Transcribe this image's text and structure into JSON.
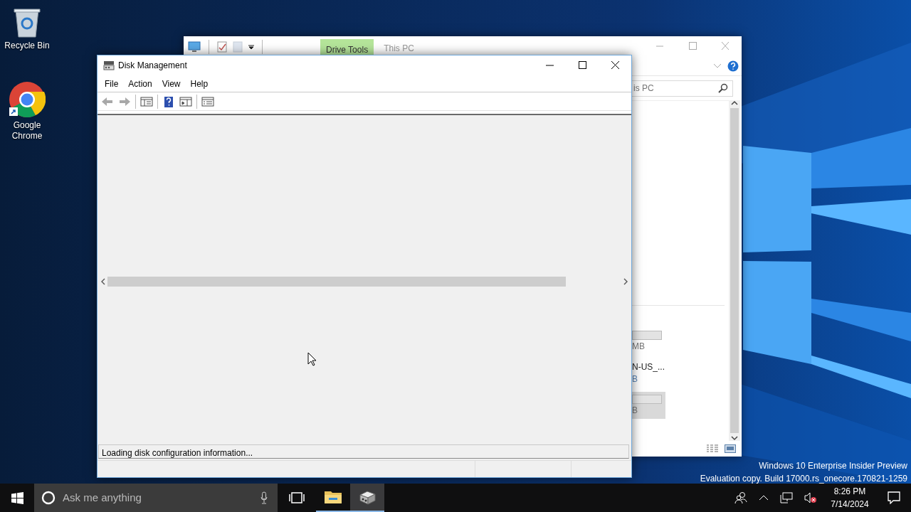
{
  "desktop_icons": [
    {
      "kind": "trash",
      "label": "Recycle Bin"
    },
    {
      "kind": "browser",
      "label": "Google Chrome"
    }
  ],
  "explorer_window": {
    "context_tab": "Drive Tools",
    "title": "This PC",
    "search": {
      "value": "is PC"
    },
    "drives": [
      {
        "kind": "bar",
        "size": "MB",
        "selected": false
      },
      {
        "kind": "label",
        "name": "N-US_...",
        "size": "B",
        "selected": false
      },
      {
        "kind": "bar",
        "size": "B",
        "selected": true
      }
    ]
  },
  "disk_management": {
    "title": "Disk Management",
    "menu": [
      "File",
      "Action",
      "View",
      "Help"
    ],
    "toolbar": [
      [
        {
          "kind": "back",
          "disabled": true
        },
        {
          "kind": "forward",
          "disabled": true
        }
      ],
      [
        {
          "kind": "tree",
          "disabled": false
        }
      ],
      [
        {
          "kind": "help",
          "disabled": false
        },
        {
          "kind": "pane",
          "disabled": false
        }
      ],
      [
        {
          "kind": "list",
          "disabled": false
        }
      ]
    ],
    "status": "Loading disk configuration information..."
  },
  "edition_notice": [
    "Windows 10 Enterprise Insider Preview",
    "Evaluation copy. Build 17000.rs_onecore.170821-1259"
  ],
  "taskbar": {
    "search_placeholder": "Ask me anything",
    "apps": [
      {
        "kind": "explorer",
        "running": true,
        "selected": false
      },
      {
        "kind": "disk",
        "running": true,
        "selected": true
      }
    ],
    "clock": {
      "time": "8:26 PM",
      "date": "7/14/2024"
    }
  }
}
